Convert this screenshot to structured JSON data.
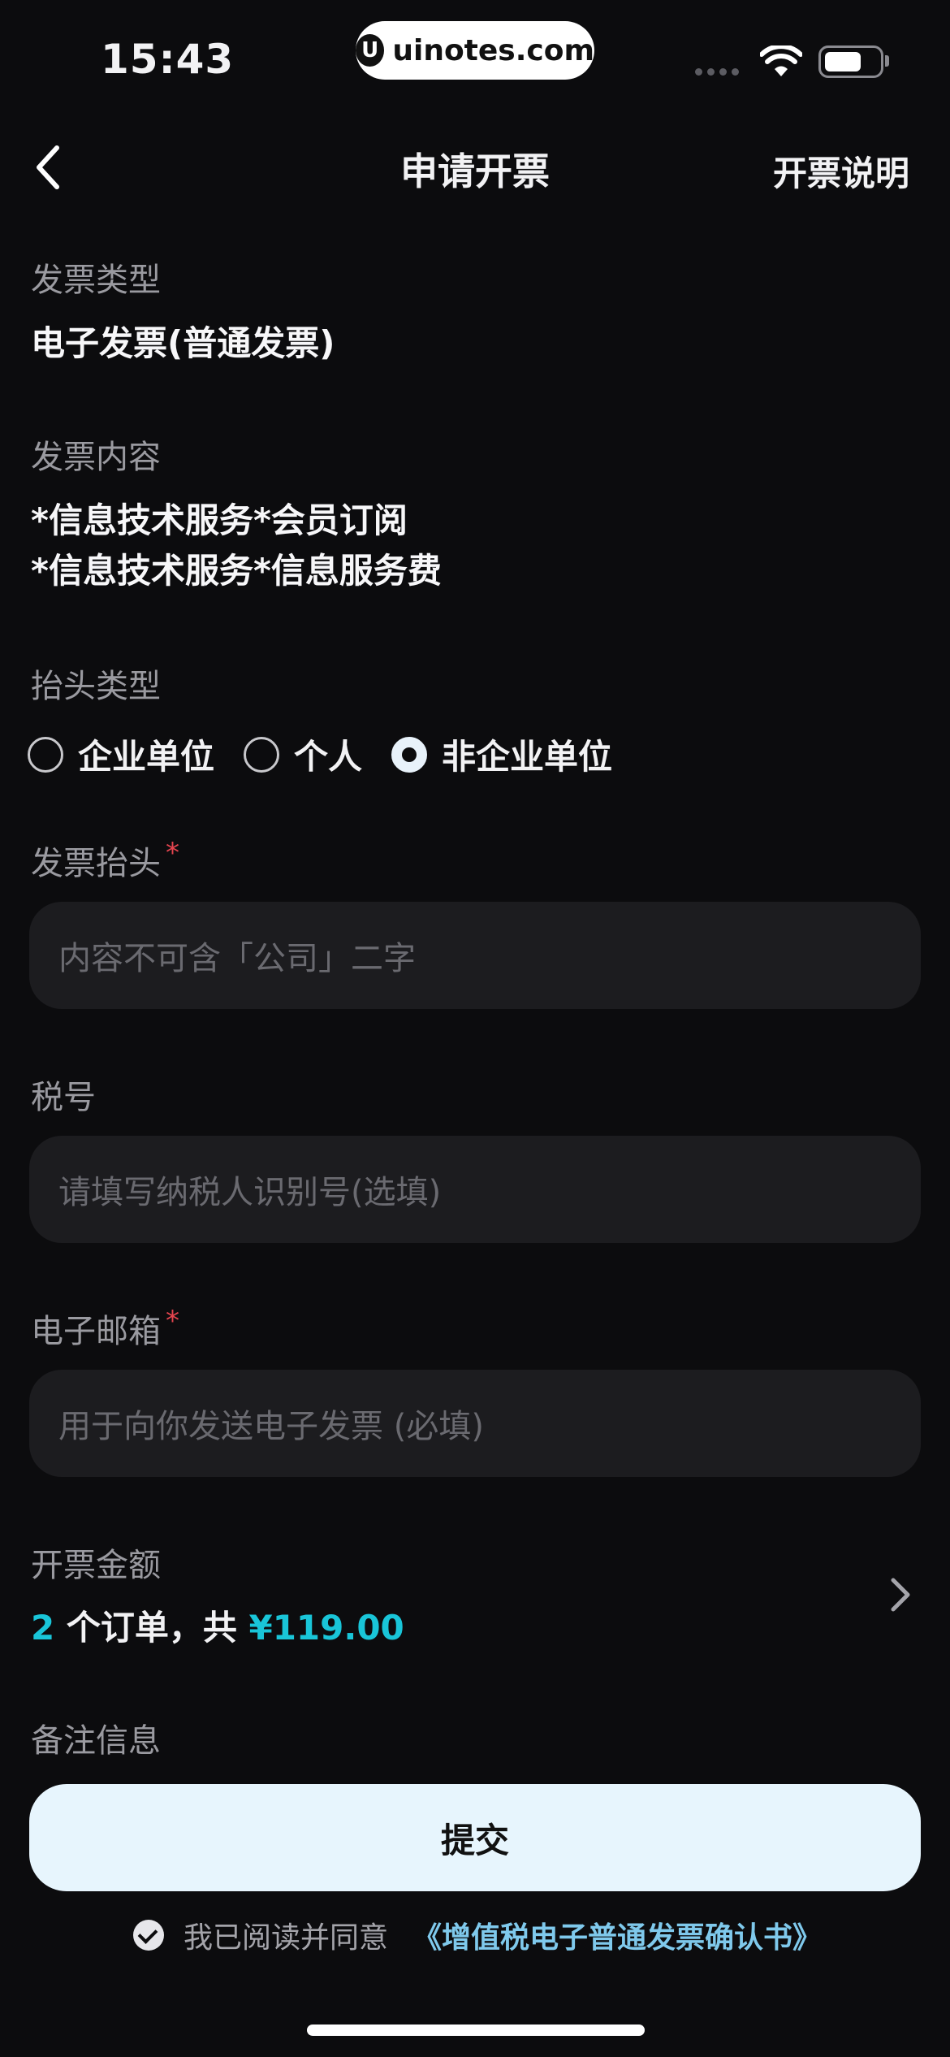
{
  "status_bar": {
    "time": "15:43",
    "watermark": "uinotes.com",
    "watermark_logo": "U"
  },
  "nav": {
    "title": "申请开票",
    "right_link": "开票说明"
  },
  "invoice_type": {
    "label": "发票类型",
    "value": "电子发票(普通发票)"
  },
  "invoice_content": {
    "label": "发票内容",
    "lines": [
      "*信息技术服务*会员订阅",
      "*信息技术服务*信息服务费"
    ]
  },
  "header_type": {
    "label": "抬头类型",
    "options": [
      {
        "label": "企业单位",
        "selected": false
      },
      {
        "label": "个人",
        "selected": false
      },
      {
        "label": "非企业单位",
        "selected": true
      }
    ]
  },
  "invoice_header": {
    "label": "发票抬头",
    "required_mark": "*",
    "placeholder": "内容不可含「公司」二字"
  },
  "tax_id": {
    "label": "税号",
    "placeholder": "请填写纳税人识别号(选填)"
  },
  "email": {
    "label": "电子邮箱",
    "required_mark": "*",
    "placeholder": "用于向你发送电子发票 (必填)"
  },
  "amount": {
    "label": "开票金额",
    "count": "2",
    "count_suffix": " 个订单，共 ",
    "total": "¥119.00"
  },
  "remark": {
    "label": "备注信息"
  },
  "submit": {
    "label": "提交"
  },
  "agreement": {
    "text": "我已阅读并同意",
    "link": "《增值税电子普通发票确认书》",
    "checked": true
  },
  "colors": {
    "accent": "#19c5d8",
    "link": "#7fc9ec",
    "required": "#e6454f",
    "button_bg": "#e7f5fd",
    "background": "#0c0c0e"
  }
}
